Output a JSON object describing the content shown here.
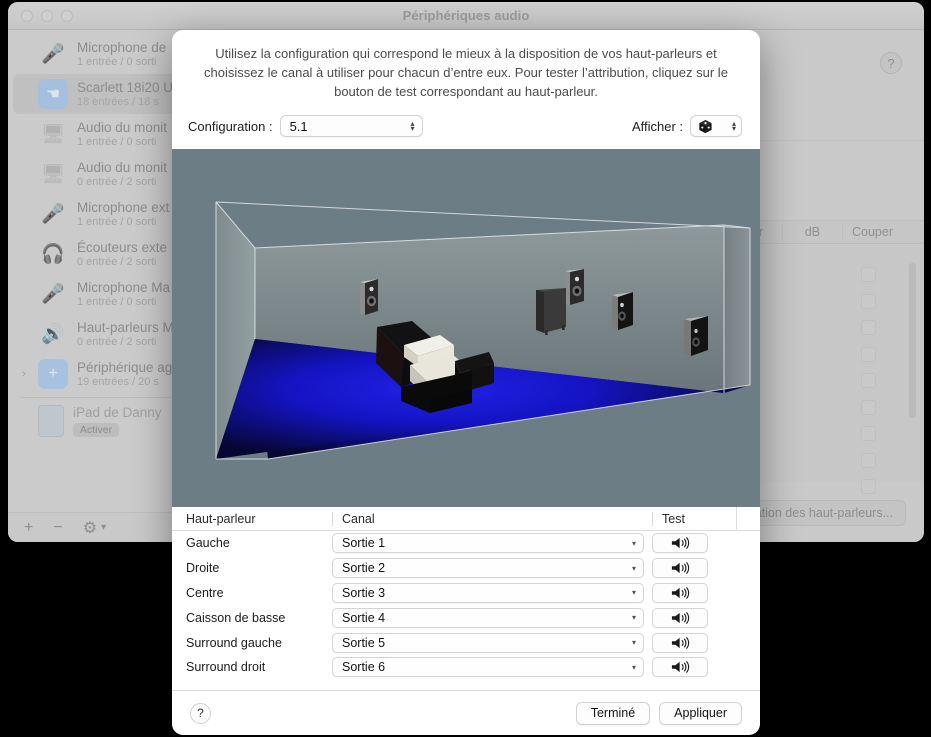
{
  "window": {
    "title": "Périphériques audio",
    "traffic_lights": [
      "close-button",
      "minimize-button",
      "zoom-button"
    ],
    "help_label": "?",
    "speaker_config_button": "Configuration des haut-parleurs...",
    "toolbar": {
      "add": "+",
      "remove": "−",
      "gear": "gear-icon",
      "chevron": "chevron-down-icon"
    },
    "channel_columns": [
      "leur",
      "dB",
      "Couper"
    ],
    "mute_checkbox_count": 10,
    "devices": [
      {
        "icon": "microphone-icon",
        "name": "Microphone de",
        "sub": "1 entrée / 0 sorti",
        "selected": false,
        "expandable": false
      },
      {
        "icon": "usb-icon",
        "name": "Scarlett 18i20 U",
        "sub": "18 entrées / 18 s",
        "selected": true,
        "expandable": false
      },
      {
        "icon": "display-icon",
        "name": "Audio du monit",
        "sub": "1 entrée / 0 sorti",
        "selected": false,
        "expandable": false
      },
      {
        "icon": "display-icon",
        "name": "Audio du monit",
        "sub": "0 entrée / 2 sorti",
        "selected": false,
        "expandable": false
      },
      {
        "icon": "microphone-icon",
        "name": "Microphone ext",
        "sub": "1 entrée / 0 sorti",
        "selected": false,
        "expandable": false
      },
      {
        "icon": "headphones-icon",
        "name": "Écouteurs exte",
        "sub": "0 entrée / 2 sorti",
        "selected": false,
        "expandable": false
      },
      {
        "icon": "microphone-icon",
        "name": "Microphone Ma",
        "sub": "1 entrée / 0 sorti",
        "selected": false,
        "expandable": false
      },
      {
        "icon": "speaker-icon",
        "name": "Haut-parleurs M",
        "sub": "0 entrée / 2 sorti",
        "selected": false,
        "expandable": false
      },
      {
        "icon": "plus-square-icon",
        "name": "Périphérique ag",
        "sub": "19 entrées / 20 s",
        "selected": false,
        "expandable": true
      }
    ],
    "ipad_device": {
      "icon": "ipad-icon",
      "name": "iPad de Danny",
      "activate_label": "Activer"
    }
  },
  "sheet": {
    "description": "Utilisez la configuration qui correspond le mieux à la disposition de vos haut-parleurs et choisissez le canal à utiliser pour chacun d’entre eux. Pour tester l’attribution, cliquez sur le bouton de test correspondant au haut-parleur.",
    "configuration_label": "Configuration :",
    "configuration_value": "5.1",
    "afficher_label": "Afficher :",
    "afficher_value": "cube-3d-icon",
    "table": {
      "headers": {
        "speaker": "Haut-parleur",
        "channel": "Canal",
        "test": "Test"
      },
      "rows": [
        {
          "speaker": "Gauche",
          "channel": "Sortie 1",
          "test": "speaker-test-icon"
        },
        {
          "speaker": "Droite",
          "channel": "Sortie 2",
          "test": "speaker-test-icon"
        },
        {
          "speaker": "Centre",
          "channel": "Sortie 3",
          "test": "speaker-test-icon"
        },
        {
          "speaker": "Caisson de basse",
          "channel": "Sortie 4",
          "test": "speaker-test-icon"
        },
        {
          "speaker": "Surround gauche",
          "channel": "Sortie 5",
          "test": "speaker-test-icon"
        },
        {
          "speaker": "Surround droit",
          "channel": "Sortie 6",
          "test": "speaker-test-icon"
        }
      ]
    },
    "footer": {
      "help": "?",
      "done": "Terminé",
      "apply": "Appliquer"
    }
  },
  "preview": {
    "background_color": "#6d7d85",
    "wall_color": "#6f7b7e",
    "floor_color": "#1717c8",
    "speaker_count": 5,
    "subwoofer_count": 1
  }
}
